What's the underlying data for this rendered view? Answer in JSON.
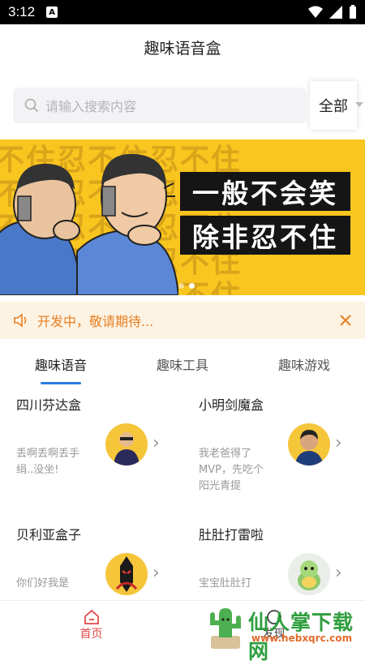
{
  "status_bar": {
    "time": "3:12",
    "notif_icon": "A"
  },
  "app": {
    "title": "趣味语音盒"
  },
  "search": {
    "placeholder": "请输入搜索内容",
    "filter": "全部"
  },
  "banner": {
    "bg_text": "不住忍不住忍不住",
    "slogan_line1": "一般不会笑",
    "slogan_line2": "除非忍不住"
  },
  "notice": {
    "text": "开发中，敬请期待..."
  },
  "tabs": [
    {
      "label": "趣味语音"
    },
    {
      "label": "趣味工具"
    },
    {
      "label": "趣味游戏"
    }
  ],
  "items": [
    {
      "name": "四川芬达盒",
      "desc": "丢啊丢啊丢手绢..没坐!"
    },
    {
      "name": "小明剑魔盒",
      "desc": "我老爸得了MVP，先吃个阳光青提"
    },
    {
      "name": "贝利亚盒子",
      "desc": "你们好我是"
    },
    {
      "name": "肚肚打雷啦",
      "desc": "宝宝肚肚打"
    }
  ],
  "nav": [
    {
      "label": "首页"
    },
    {
      "label": "发现"
    }
  ],
  "watermark": {
    "text": "仙人掌下载网",
    "url": "www.hebxqrc.com"
  },
  "colors": {
    "accent": "#2a7de1",
    "notice": "#e67e22",
    "nav_active": "#e04848",
    "banner": "#f9c51f"
  }
}
